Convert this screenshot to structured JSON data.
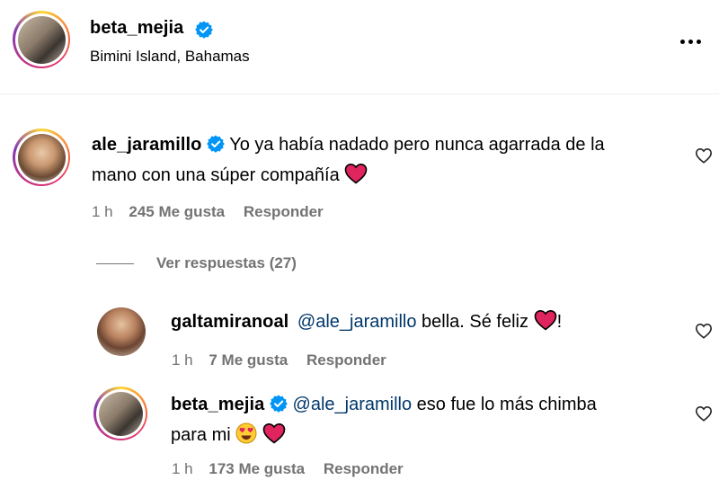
{
  "post": {
    "author": "beta_mejia",
    "location": "Bimini Island, Bahamas"
  },
  "comment": {
    "username": "ale_jaramillo",
    "text_line1": "Yo ya había nadado pero nunca agarrada de la",
    "text_line2": "mano con una súper compañía",
    "time": "1 h",
    "likes": "245 Me gusta",
    "reply": "Responder",
    "view_replies": "Ver respuestas (27)"
  },
  "replies": [
    {
      "username": "galtamiranoal",
      "mention": "@ale_jaramillo",
      "text": "bella. Sé feliz",
      "after_emoji": "!",
      "time": "1 h",
      "likes": "7 Me gusta",
      "reply": "Responder"
    },
    {
      "username": "beta_mejia",
      "mention": "@ale_jaramillo",
      "text": "eso fue lo más chimba",
      "text_line2": "para mi",
      "time": "1 h",
      "likes": "173 Me gusta",
      "reply": "Responder"
    }
  ],
  "colors": {
    "verified": "#0095f6",
    "secondary_text": "#737373",
    "mention": "#00376b",
    "heart": "#e0245e"
  }
}
